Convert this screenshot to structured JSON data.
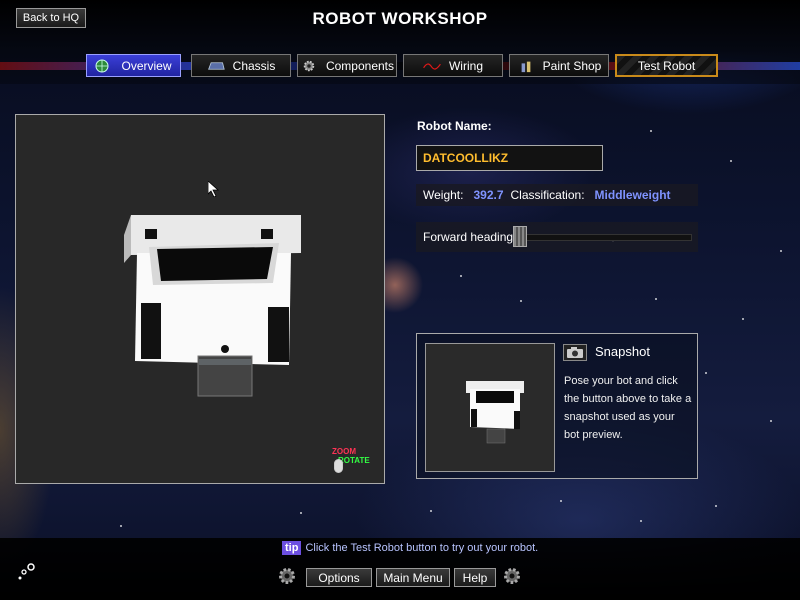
{
  "header": {
    "back_button": "Back to HQ",
    "title": "ROBOT WORKSHOP"
  },
  "tabs": [
    {
      "label": "Overview",
      "icon": "globe-icon",
      "active": true
    },
    {
      "label": "Chassis",
      "icon": "chassis-icon",
      "active": false
    },
    {
      "label": "Components",
      "icon": "gear-icon",
      "active": false
    },
    {
      "label": "Wiring",
      "icon": "wire-icon",
      "active": false
    },
    {
      "label": "Paint Shop",
      "icon": "paint-icon",
      "active": false
    },
    {
      "label": "Test Robot",
      "icon": "",
      "active": false
    }
  ],
  "viewer": {
    "zoom_hint": "ZOOM",
    "rotate_hint": "ROTATE"
  },
  "robot": {
    "name_label": "Robot Name:",
    "name_value": "DATCOOLLIKZ",
    "weight_label": "Weight:",
    "weight_value": "392.7",
    "class_label": "Classification:",
    "class_value": "Middleweight",
    "heading_label": "Forward heading:",
    "heading_level": 0.0
  },
  "snapshot": {
    "title": "Snapshot",
    "description": "Pose your bot and click the button above to take a snapshot used as your bot preview."
  },
  "footer": {
    "tip_badge": "tip",
    "tip_text": "Click the Test Robot button to try out your robot.",
    "options": "Options",
    "main_menu": "Main Menu",
    "help": "Help"
  },
  "colors": {
    "accent_name": "#ffbd2e",
    "accent_stat": "#7f93ff",
    "active_tab": "#3b3fd8",
    "test_border": "#c98a1a"
  }
}
